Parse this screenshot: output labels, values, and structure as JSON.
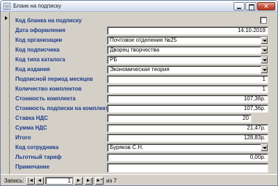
{
  "window": {
    "title": "Бланк на подписку"
  },
  "fields": [
    {
      "label": "Код бланка на подписку",
      "value": "",
      "type": "text"
    },
    {
      "label": "Дата оформления",
      "value": "14.10.2019",
      "type": "text"
    },
    {
      "label": "Код организации",
      "value": "Почтовое отделение №25",
      "type": "combo"
    },
    {
      "label": "Код подписчика",
      "value": "Дворец творчества",
      "type": "combo"
    },
    {
      "label": "Код типа каталога",
      "value": "РБ",
      "type": "combo"
    },
    {
      "label": "Код издания",
      "value": "Экономическая теория",
      "type": "combo"
    },
    {
      "label": "Подписной период месяцев",
      "value": "1",
      "type": "text"
    },
    {
      "label": "Количество комплектов",
      "value": "1",
      "type": "text"
    },
    {
      "label": "Стоимость комплекта",
      "value": "107,36р.",
      "type": "text"
    },
    {
      "label": "Стоимость подписки на комплект",
      "value": "107,36р.",
      "type": "text"
    },
    {
      "label": "Ставка НДС",
      "value": "20",
      "type": "text"
    },
    {
      "label": "Сумма НДС",
      "value": "21,47р.",
      "type": "text"
    },
    {
      "label": "Итого",
      "value": "128,83р.",
      "type": "text"
    },
    {
      "label": "Код сотрудника",
      "value": "Буряков С.Н.",
      "type": "combo"
    },
    {
      "label": "Льготный тариф",
      "value": "0,00р.",
      "type": "text"
    },
    {
      "label": "Примечание",
      "value": "",
      "type": "memo"
    }
  ],
  "navigation": {
    "label": "Запись:",
    "current": "1",
    "of_text": "из 7",
    "buttons": {
      "first": "|◄",
      "prev": "◄",
      "next": "►",
      "last": "►|",
      "new": "►*"
    }
  }
}
